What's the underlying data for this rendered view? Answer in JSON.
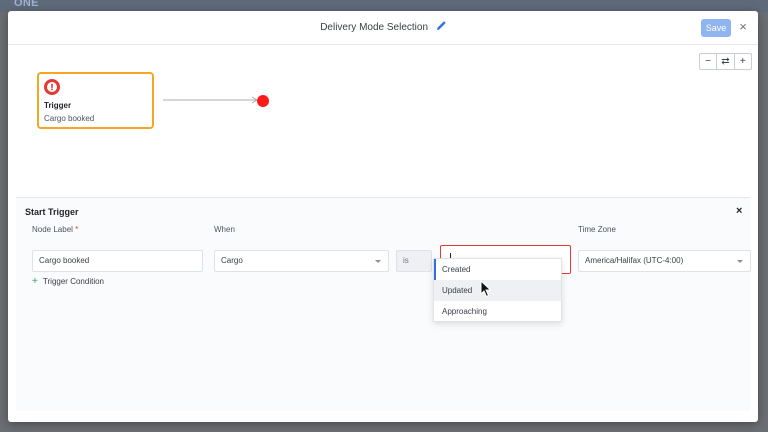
{
  "app": {
    "logo_text": "ONE"
  },
  "modal": {
    "title": "Delivery Mode Selection",
    "save_label": "Save",
    "close_glyph": "×"
  },
  "zoom": {
    "out": "−",
    "reset": "⇄",
    "in": "+"
  },
  "canvas": {
    "trigger_node": {
      "title": "Trigger",
      "subtitle": "Cargo booked",
      "icon": "alert-icon",
      "border_color": "#f5a623"
    },
    "end_node_color": "#ff1a1a"
  },
  "panel": {
    "title": "Start Trigger",
    "close_glyph": "×",
    "node_label": {
      "label": "Node Label",
      "required_mark": "*",
      "value": "Cargo booked"
    },
    "when": {
      "label": "When",
      "value": "Cargo"
    },
    "operator": {
      "value": "is"
    },
    "event": {
      "value": ""
    },
    "time_zone": {
      "label": "Time Zone",
      "value": "America/Halifax (UTC-4:00)"
    },
    "add_condition": {
      "plus": "+",
      "label": "Trigger Condition"
    }
  },
  "dropdown": {
    "options": [
      "Created",
      "Updated",
      "Approaching"
    ]
  },
  "colors": {
    "accent": "#2f6fdf",
    "save_button": "#8fb4f0",
    "error_outline": "#e53935"
  }
}
